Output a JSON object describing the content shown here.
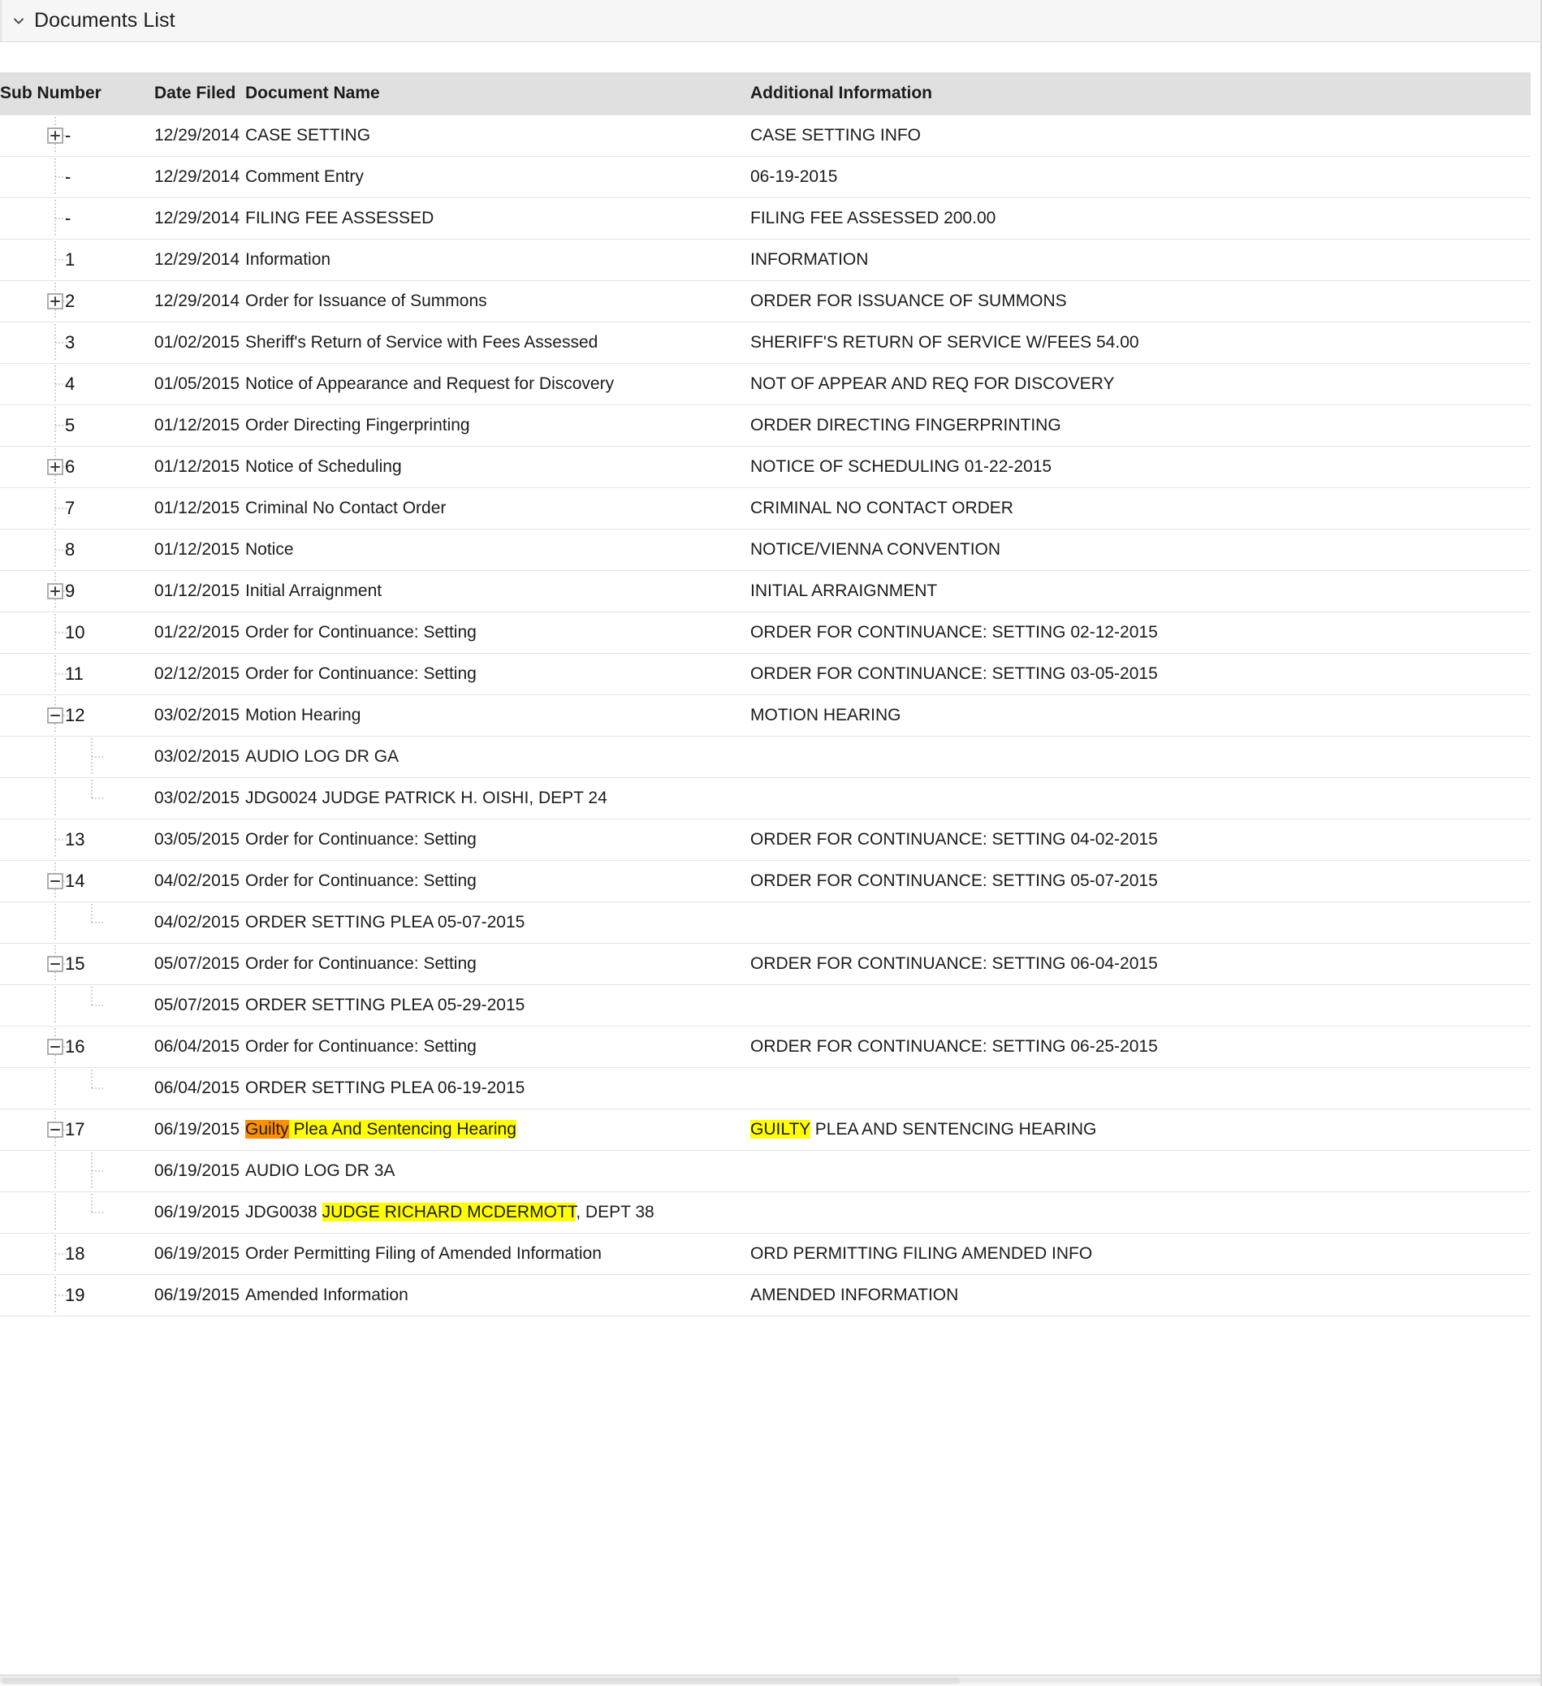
{
  "section": {
    "title": "Documents List",
    "toggle_icon": "chevron-down-icon",
    "expanded": true
  },
  "table": {
    "columns": [
      {
        "key": "sub_number",
        "label": "Sub Number"
      },
      {
        "key": "date_filed",
        "label": "Date Filed"
      },
      {
        "key": "document_name",
        "label": "Document Name"
      },
      {
        "key": "additional_information",
        "label": "Additional Information"
      }
    ],
    "rows": [
      {
        "tree": "expandable",
        "depth": 0,
        "sub_number": "-",
        "date_filed": "12/29/2014",
        "document_name": "CASE SETTING",
        "additional_information": "CASE SETTING INFO"
      },
      {
        "tree": "leaf",
        "depth": 0,
        "sub_number": "-",
        "date_filed": "12/29/2014",
        "document_name": "Comment Entry",
        "additional_information": "06-19-2015"
      },
      {
        "tree": "leaf",
        "depth": 0,
        "sub_number": "-",
        "date_filed": "12/29/2014",
        "document_name": "FILING FEE ASSESSED",
        "additional_information": "FILING FEE ASSESSED 200.00"
      },
      {
        "tree": "leaf",
        "depth": 0,
        "sub_number": "1",
        "date_filed": "12/29/2014",
        "document_name": "Information",
        "additional_information": "INFORMATION"
      },
      {
        "tree": "expandable",
        "depth": 0,
        "sub_number": "2",
        "date_filed": "12/29/2014",
        "document_name": "Order for Issuance of Summons",
        "additional_information": "ORDER FOR ISSUANCE OF SUMMONS"
      },
      {
        "tree": "leaf",
        "depth": 0,
        "sub_number": "3",
        "date_filed": "01/02/2015",
        "document_name": "Sheriff's Return of Service with Fees Assessed",
        "additional_information": "SHERIFF'S RETURN OF SERVICE W/FEES 54.00"
      },
      {
        "tree": "leaf",
        "depth": 0,
        "sub_number": "4",
        "date_filed": "01/05/2015",
        "document_name": "Notice of Appearance and Request for Discovery",
        "additional_information": "NOT OF APPEAR AND REQ FOR DISCOVERY"
      },
      {
        "tree": "leaf",
        "depth": 0,
        "sub_number": "5",
        "date_filed": "01/12/2015",
        "document_name": "Order Directing Fingerprinting",
        "additional_information": "ORDER DIRECTING FINGERPRINTING"
      },
      {
        "tree": "expandable",
        "depth": 0,
        "sub_number": "6",
        "date_filed": "01/12/2015",
        "document_name": "Notice of Scheduling",
        "additional_information": "NOTICE OF SCHEDULING 01-22-2015"
      },
      {
        "tree": "leaf",
        "depth": 0,
        "sub_number": "7",
        "date_filed": "01/12/2015",
        "document_name": "Criminal No Contact Order",
        "additional_information": "CRIMINAL NO CONTACT ORDER"
      },
      {
        "tree": "leaf",
        "depth": 0,
        "sub_number": "8",
        "date_filed": "01/12/2015",
        "document_name": "Notice",
        "additional_information": "NOTICE/VIENNA CONVENTION"
      },
      {
        "tree": "expandable",
        "depth": 0,
        "sub_number": "9",
        "date_filed": "01/12/2015",
        "document_name": "Initial Arraignment",
        "additional_information": "INITIAL ARRAIGNMENT"
      },
      {
        "tree": "leaf",
        "depth": 0,
        "sub_number": "10",
        "date_filed": "01/22/2015",
        "document_name": "Order for Continuance: Setting",
        "additional_information": "ORDER FOR CONTINUANCE: SETTING 02-12-2015"
      },
      {
        "tree": "leaf",
        "depth": 0,
        "sub_number": "11",
        "date_filed": "02/12/2015",
        "document_name": "Order for Continuance: Setting",
        "additional_information": "ORDER FOR CONTINUANCE: SETTING 03-05-2015"
      },
      {
        "tree": "expanded",
        "depth": 0,
        "sub_number": "12",
        "date_filed": "03/02/2015",
        "document_name": "Motion Hearing",
        "additional_information": "MOTION HEARING"
      },
      {
        "tree": "child",
        "depth": 1,
        "sub_number": "",
        "date_filed": "03/02/2015",
        "document_name": "AUDIO LOG DR GA",
        "additional_information": ""
      },
      {
        "tree": "child-last",
        "depth": 1,
        "sub_number": "",
        "date_filed": "03/02/2015",
        "document_name": "JDG0024 JUDGE PATRICK H. OISHI, DEPT 24",
        "additional_information": ""
      },
      {
        "tree": "leaf",
        "depth": 0,
        "sub_number": "13",
        "date_filed": "03/05/2015",
        "document_name": "Order for Continuance: Setting",
        "additional_information": "ORDER FOR CONTINUANCE: SETTING 04-02-2015"
      },
      {
        "tree": "expanded",
        "depth": 0,
        "sub_number": "14",
        "date_filed": "04/02/2015",
        "document_name": "Order for Continuance: Setting",
        "additional_information": "ORDER FOR CONTINUANCE: SETTING 05-07-2015"
      },
      {
        "tree": "child-last",
        "depth": 1,
        "sub_number": "",
        "date_filed": "04/02/2015",
        "document_name": "ORDER SETTING PLEA 05-07-2015",
        "additional_information": ""
      },
      {
        "tree": "expanded",
        "depth": 0,
        "sub_number": "15",
        "date_filed": "05/07/2015",
        "document_name": "Order for Continuance: Setting",
        "additional_information": "ORDER FOR CONTINUANCE: SETTING 06-04-2015"
      },
      {
        "tree": "child-last",
        "depth": 1,
        "sub_number": "",
        "date_filed": "05/07/2015",
        "document_name": "ORDER SETTING PLEA 05-29-2015",
        "additional_information": ""
      },
      {
        "tree": "expanded",
        "depth": 0,
        "sub_number": "16",
        "date_filed": "06/04/2015",
        "document_name": "Order for Continuance: Setting",
        "additional_information": "ORDER FOR CONTINUANCE: SETTING 06-25-2015"
      },
      {
        "tree": "child-last",
        "depth": 1,
        "sub_number": "",
        "date_filed": "06/04/2015",
        "document_name": "ORDER SETTING PLEA 06-19-2015",
        "additional_information": ""
      },
      {
        "tree": "expanded",
        "depth": 0,
        "sub_number": "17",
        "date_filed": "06/19/2015",
        "document_name": "Guilty Plea And Sentencing Hearing",
        "document_name_parts": [
          {
            "text": "Guilty",
            "highlight": "orange",
            "outer": "yellow"
          },
          {
            "text": " Plea And Sentencing Hearing",
            "highlight": "yellow"
          }
        ],
        "additional_information": "GUILTY PLEA AND SENTENCING HEARING",
        "additional_information_parts": [
          {
            "text": "GUILTY",
            "highlight": "yellow"
          },
          {
            "text": " PLEA AND SENTENCING HEARING",
            "highlight": "none"
          }
        ]
      },
      {
        "tree": "child",
        "depth": 1,
        "sub_number": "",
        "date_filed": "06/19/2015",
        "document_name": "AUDIO LOG DR 3A",
        "additional_information": ""
      },
      {
        "tree": "child-last",
        "depth": 1,
        "sub_number": "",
        "date_filed": "06/19/2015",
        "document_name": "JDG0038 JUDGE RICHARD MCDERMOTT, DEPT 38",
        "document_name_parts": [
          {
            "text": "JDG0038 ",
            "highlight": "none"
          },
          {
            "text": "JUDGE RICHARD MCDERMOTT",
            "highlight": "yellow"
          },
          {
            "text": ", DEPT 38",
            "highlight": "none"
          }
        ],
        "additional_information": ""
      },
      {
        "tree": "leaf",
        "depth": 0,
        "sub_number": "18",
        "date_filed": "06/19/2015",
        "document_name": "Order Permitting Filing of Amended Information",
        "additional_information": "ORD PERMITTING FILING AMENDED INFO"
      },
      {
        "tree": "leaf",
        "depth": 0,
        "sub_number": "19",
        "date_filed": "06/19/2015",
        "document_name": "Amended Information",
        "additional_information": "AMENDED INFORMATION"
      }
    ]
  },
  "scrollbar": {
    "orientation": "horizontal",
    "name": "horizontal-scrollbar"
  },
  "colors": {
    "header_bg": "#e0e0e0",
    "panel_header_bg": "#f6f6f6",
    "row_border": "#e4e4e4",
    "text": "#1c1c1c",
    "highlight_yellow": "#ffff00",
    "highlight_orange": "#ff9000"
  }
}
